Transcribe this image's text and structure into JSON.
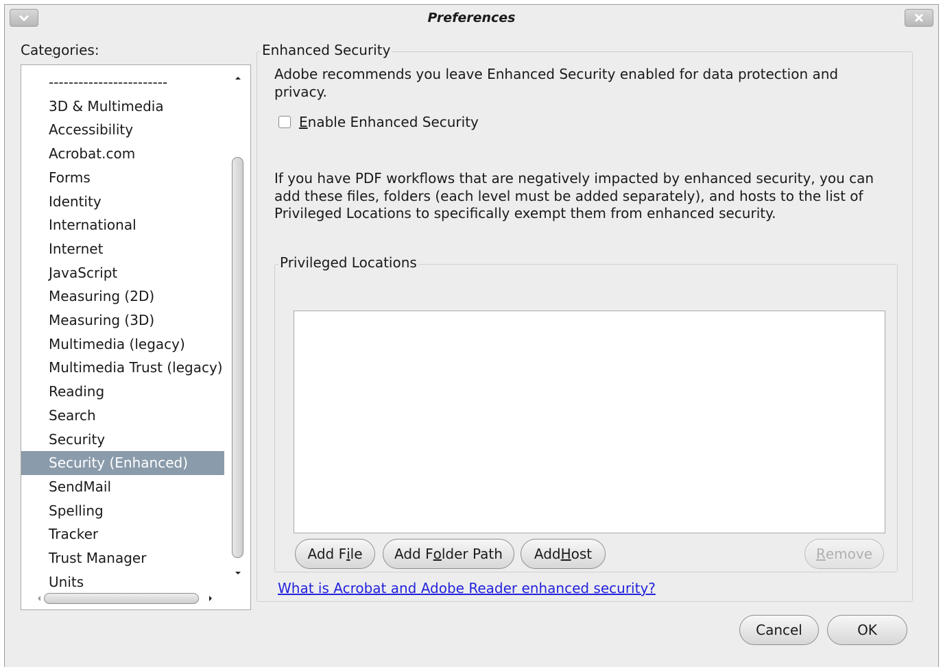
{
  "window": {
    "title": "Preferences",
    "menu_icon": "chevron-down-icon",
    "close_icon": "close-icon"
  },
  "categories": {
    "label_pre": "Cate",
    "label_mnemonic": "g",
    "label_post": "ories:",
    "items": [
      "------------------------",
      "3D & Multimedia",
      "Accessibility",
      "Acrobat.com",
      "Forms",
      "Identity",
      "International",
      "Internet",
      "JavaScript",
      "Measuring (2D)",
      "Measuring (3D)",
      "Multimedia (legacy)",
      "Multimedia Trust (legacy)",
      "Reading",
      "Search",
      "Security",
      "Security (Enhanced)",
      "SendMail",
      "Spelling",
      "Tracker",
      "Trust Manager",
      "Units"
    ],
    "selected": "Security (Enhanced)"
  },
  "enhanced_security": {
    "legend": "Enhanced Security",
    "recommendation": "Adobe recommends you leave Enhanced Security enabled for data protection and privacy.",
    "checkbox_mnemonic": "E",
    "checkbox_rest": "nable Enhanced Security",
    "checkbox_checked": false,
    "workflow_note": "If you have PDF workflows that are negatively impacted by enhanced security, you can add these files, folders (each level must be added separately), and hosts to the list of Privileged Locations to specifically exempt them from enhanced security."
  },
  "privileged_locations": {
    "legend": "Privileged Locations",
    "entries": [],
    "add_file": {
      "pre": "Add F",
      "mnemonic": "i",
      "post": "le"
    },
    "add_folder": {
      "pre": "Add F",
      "mnemonic": "o",
      "post": "lder Path"
    },
    "add_host": {
      "pre": "Add ",
      "mnemonic": "H",
      "post": "ost"
    },
    "remove": {
      "pre": "",
      "mnemonic": "R",
      "post": "emove"
    },
    "remove_enabled": false
  },
  "help_link": "What is Acrobat and Adobe Reader enhanced security?",
  "footer": {
    "cancel": "Cancel",
    "ok": "OK"
  }
}
